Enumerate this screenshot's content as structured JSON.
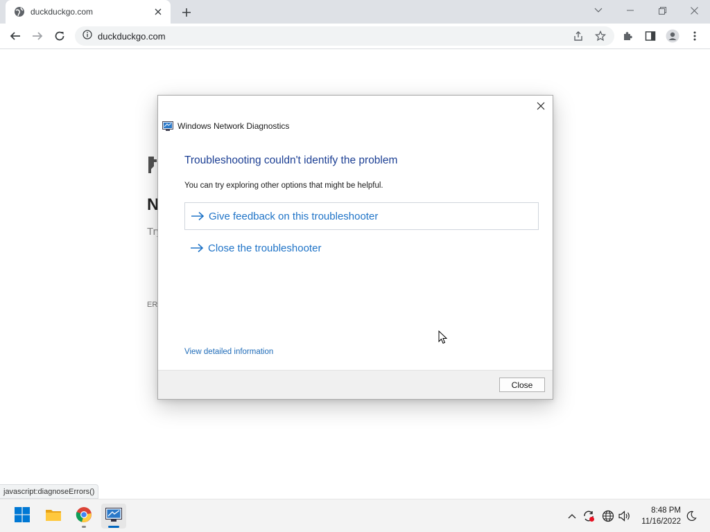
{
  "browser": {
    "tab_title": "duckduckgo.com",
    "url": "duckduckgo.com"
  },
  "page": {
    "heading_fragment": "N",
    "text_fragment": "Try",
    "error_fragment": "ERI"
  },
  "dialog": {
    "window_title": "Windows Network Diagnostics",
    "heading": "Troubleshooting couldn't identify the problem",
    "description": "You can try exploring other options that might be helpful.",
    "options": [
      {
        "label": "Give feedback on this troubleshooter"
      },
      {
        "label": "Close the troubleshooter"
      }
    ],
    "details_link": "View detailed information",
    "close_button": "Close"
  },
  "status_bar": {
    "text": "javascript:diagnoseErrors()"
  },
  "taskbar": {
    "time": "8:48 PM",
    "date": "11/16/2022"
  },
  "colors": {
    "heading_blue": "#1c3f94",
    "link_blue": "#1e73c7",
    "windows_blue": "#0067c0"
  }
}
